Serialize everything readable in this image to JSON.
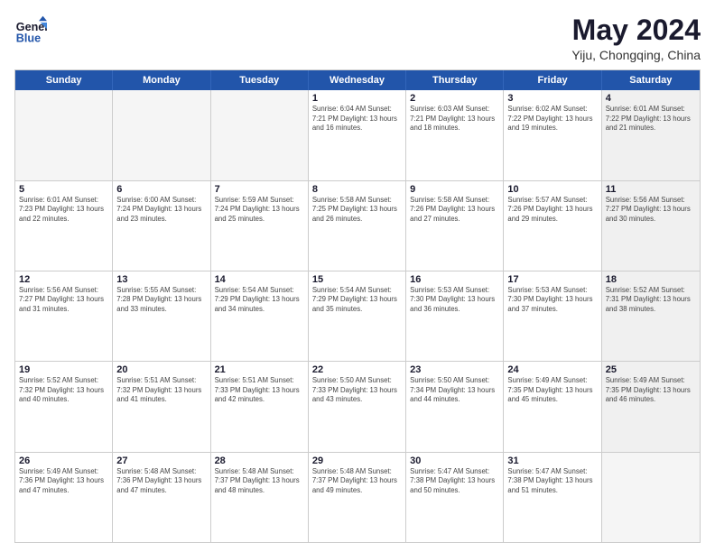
{
  "logo": {
    "line1": "General",
    "line2": "Blue"
  },
  "title": "May 2024",
  "subtitle": "Yiju, Chongqing, China",
  "days_of_week": [
    "Sunday",
    "Monday",
    "Tuesday",
    "Wednesday",
    "Thursday",
    "Friday",
    "Saturday"
  ],
  "weeks": [
    [
      {
        "day": "",
        "info": "",
        "empty": true
      },
      {
        "day": "",
        "info": "",
        "empty": true
      },
      {
        "day": "",
        "info": "",
        "empty": true
      },
      {
        "day": "1",
        "info": "Sunrise: 6:04 AM\nSunset: 7:21 PM\nDaylight: 13 hours\nand 16 minutes."
      },
      {
        "day": "2",
        "info": "Sunrise: 6:03 AM\nSunset: 7:21 PM\nDaylight: 13 hours\nand 18 minutes."
      },
      {
        "day": "3",
        "info": "Sunrise: 6:02 AM\nSunset: 7:22 PM\nDaylight: 13 hours\nand 19 minutes."
      },
      {
        "day": "4",
        "info": "Sunrise: 6:01 AM\nSunset: 7:22 PM\nDaylight: 13 hours\nand 21 minutes.",
        "shaded": true
      }
    ],
    [
      {
        "day": "5",
        "info": "Sunrise: 6:01 AM\nSunset: 7:23 PM\nDaylight: 13 hours\nand 22 minutes."
      },
      {
        "day": "6",
        "info": "Sunrise: 6:00 AM\nSunset: 7:24 PM\nDaylight: 13 hours\nand 23 minutes."
      },
      {
        "day": "7",
        "info": "Sunrise: 5:59 AM\nSunset: 7:24 PM\nDaylight: 13 hours\nand 25 minutes."
      },
      {
        "day": "8",
        "info": "Sunrise: 5:58 AM\nSunset: 7:25 PM\nDaylight: 13 hours\nand 26 minutes."
      },
      {
        "day": "9",
        "info": "Sunrise: 5:58 AM\nSunset: 7:26 PM\nDaylight: 13 hours\nand 27 minutes."
      },
      {
        "day": "10",
        "info": "Sunrise: 5:57 AM\nSunset: 7:26 PM\nDaylight: 13 hours\nand 29 minutes."
      },
      {
        "day": "11",
        "info": "Sunrise: 5:56 AM\nSunset: 7:27 PM\nDaylight: 13 hours\nand 30 minutes.",
        "shaded": true
      }
    ],
    [
      {
        "day": "12",
        "info": "Sunrise: 5:56 AM\nSunset: 7:27 PM\nDaylight: 13 hours\nand 31 minutes."
      },
      {
        "day": "13",
        "info": "Sunrise: 5:55 AM\nSunset: 7:28 PM\nDaylight: 13 hours\nand 33 minutes."
      },
      {
        "day": "14",
        "info": "Sunrise: 5:54 AM\nSunset: 7:29 PM\nDaylight: 13 hours\nand 34 minutes."
      },
      {
        "day": "15",
        "info": "Sunrise: 5:54 AM\nSunset: 7:29 PM\nDaylight: 13 hours\nand 35 minutes."
      },
      {
        "day": "16",
        "info": "Sunrise: 5:53 AM\nSunset: 7:30 PM\nDaylight: 13 hours\nand 36 minutes."
      },
      {
        "day": "17",
        "info": "Sunrise: 5:53 AM\nSunset: 7:30 PM\nDaylight: 13 hours\nand 37 minutes."
      },
      {
        "day": "18",
        "info": "Sunrise: 5:52 AM\nSunset: 7:31 PM\nDaylight: 13 hours\nand 38 minutes.",
        "shaded": true
      }
    ],
    [
      {
        "day": "19",
        "info": "Sunrise: 5:52 AM\nSunset: 7:32 PM\nDaylight: 13 hours\nand 40 minutes."
      },
      {
        "day": "20",
        "info": "Sunrise: 5:51 AM\nSunset: 7:32 PM\nDaylight: 13 hours\nand 41 minutes."
      },
      {
        "day": "21",
        "info": "Sunrise: 5:51 AM\nSunset: 7:33 PM\nDaylight: 13 hours\nand 42 minutes."
      },
      {
        "day": "22",
        "info": "Sunrise: 5:50 AM\nSunset: 7:33 PM\nDaylight: 13 hours\nand 43 minutes."
      },
      {
        "day": "23",
        "info": "Sunrise: 5:50 AM\nSunset: 7:34 PM\nDaylight: 13 hours\nand 44 minutes."
      },
      {
        "day": "24",
        "info": "Sunrise: 5:49 AM\nSunset: 7:35 PM\nDaylight: 13 hours\nand 45 minutes."
      },
      {
        "day": "25",
        "info": "Sunrise: 5:49 AM\nSunset: 7:35 PM\nDaylight: 13 hours\nand 46 minutes.",
        "shaded": true
      }
    ],
    [
      {
        "day": "26",
        "info": "Sunrise: 5:49 AM\nSunset: 7:36 PM\nDaylight: 13 hours\nand 47 minutes."
      },
      {
        "day": "27",
        "info": "Sunrise: 5:48 AM\nSunset: 7:36 PM\nDaylight: 13 hours\nand 47 minutes."
      },
      {
        "day": "28",
        "info": "Sunrise: 5:48 AM\nSunset: 7:37 PM\nDaylight: 13 hours\nand 48 minutes."
      },
      {
        "day": "29",
        "info": "Sunrise: 5:48 AM\nSunset: 7:37 PM\nDaylight: 13 hours\nand 49 minutes."
      },
      {
        "day": "30",
        "info": "Sunrise: 5:47 AM\nSunset: 7:38 PM\nDaylight: 13 hours\nand 50 minutes."
      },
      {
        "day": "31",
        "info": "Sunrise: 5:47 AM\nSunset: 7:38 PM\nDaylight: 13 hours\nand 51 minutes."
      },
      {
        "day": "",
        "info": "",
        "empty": true,
        "shaded": true
      }
    ]
  ]
}
